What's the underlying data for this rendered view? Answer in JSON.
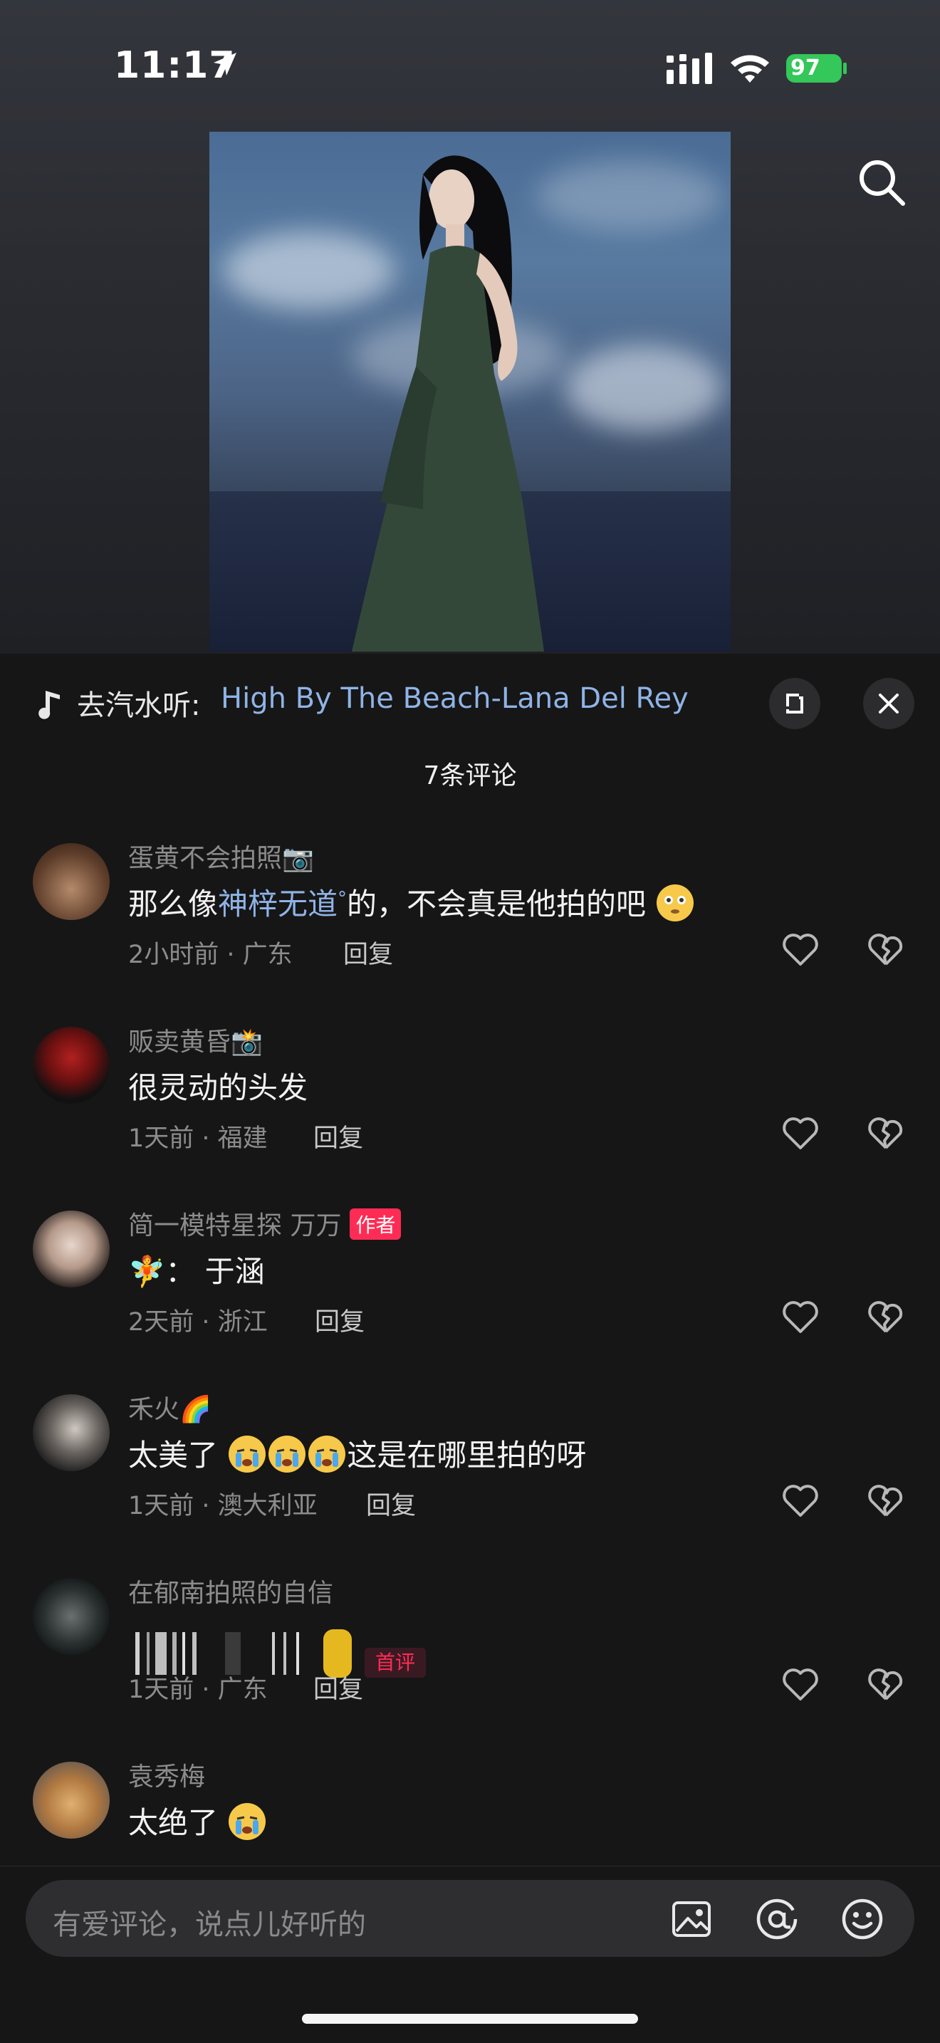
{
  "status_bar": {
    "time": "11:17",
    "battery": "97"
  },
  "music": {
    "prefix": "去汽水听:",
    "song": "High By The Beach-Lana Del Rey"
  },
  "comment_count": "7条评论",
  "comments": [
    {
      "user": "蛋黄不会拍照📷",
      "text_pre": "那么像",
      "text_link": "神梓无道",
      "text_post": "的，不会真是他拍的吧",
      "meta": "2小时前 · 广东",
      "reply": "回复"
    },
    {
      "user": "贩卖黄昏📸",
      "text": "很灵动的头发",
      "meta": "1天前 · 福建",
      "reply": "回复"
    },
    {
      "user": "简一模特星探  万万",
      "badge": "作者",
      "text_emoji": "🧚",
      "text": "： 于涵",
      "meta": "2天前 · 浙江",
      "reply": "回复"
    },
    {
      "user": "禾火🌈",
      "text_pre": "太美了",
      "text_post": "这是在哪里拍的呀",
      "meta": "1天前 · 澳大利亚",
      "reply": "回复"
    },
    {
      "user": "在郁南拍照的自信",
      "badge": "首评",
      "meta": "1天前 · 广东",
      "reply": "回复"
    },
    {
      "user": "袁秀梅",
      "text_pre": "太绝了"
    }
  ],
  "input": {
    "placeholder": "有爱评论，说点儿好听的"
  },
  "icons": [
    "location-arrow-icon",
    "signal-icon",
    "wifi-icon",
    "battery-icon",
    "search-icon",
    "music-note-icon",
    "expand-icon",
    "close-icon",
    "heart-icon",
    "broken-heart-icon",
    "image-icon",
    "at-icon",
    "emoji-icon"
  ],
  "colors": {
    "link": "#8fb3e6",
    "author_badge": "#fe2c55",
    "background": "#161616"
  }
}
